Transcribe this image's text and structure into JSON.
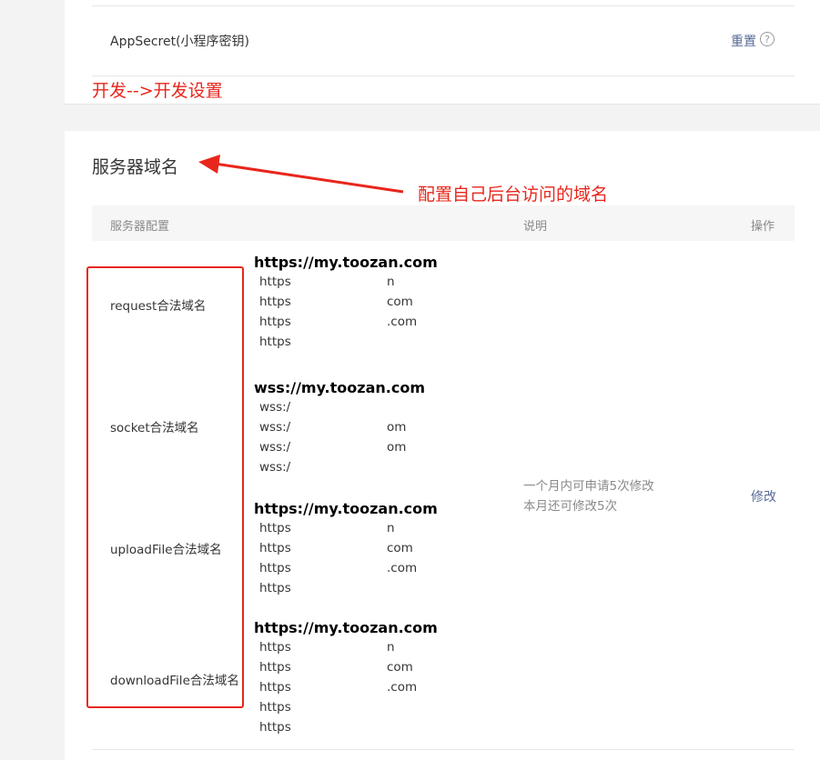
{
  "app_secret": {
    "label": "AppSecret(小程序密钥)",
    "reset_label": "重置",
    "help_icon": "?"
  },
  "annotations": {
    "dev_path": "开发-->开发设置",
    "server_note": "配置自己后台访问的域名"
  },
  "server_domain": {
    "title": "服务器域名",
    "columns": {
      "config": "服务器配置",
      "description": "说明",
      "operation": "操作"
    },
    "rows": [
      {
        "label": "request合法域名",
        "head": "https://my.toozan.com",
        "lines": [
          {
            "prefix": "https",
            "suffix": "n"
          },
          {
            "prefix": "https",
            "suffix": "com"
          },
          {
            "prefix": "https",
            "suffix": ".com"
          },
          {
            "prefix": "https",
            "suffix": ""
          }
        ]
      },
      {
        "label": "socket合法域名",
        "head": "wss://my.toozan.com",
        "lines": [
          {
            "prefix": "wss:/",
            "suffix": ""
          },
          {
            "prefix": "wss:/",
            "suffix": "om"
          },
          {
            "prefix": "wss:/",
            "suffix": "om"
          },
          {
            "prefix": "wss:/",
            "suffix": ""
          }
        ]
      },
      {
        "label": "uploadFile合法域名",
        "head": "https://my.toozan.com",
        "lines": [
          {
            "prefix": "https",
            "suffix": "n"
          },
          {
            "prefix": "https",
            "suffix": "com"
          },
          {
            "prefix": "https",
            "suffix": ".com"
          },
          {
            "prefix": "https",
            "suffix": ""
          }
        ]
      },
      {
        "label": "downloadFile合法域名",
        "head": "https://my.toozan.com",
        "lines": [
          {
            "prefix": "https",
            "suffix": "n"
          },
          {
            "prefix": "https",
            "suffix": "com"
          },
          {
            "prefix": "https",
            "suffix": ".com"
          },
          {
            "prefix": "https",
            "suffix": ""
          },
          {
            "prefix": "https",
            "suffix": ""
          }
        ]
      }
    ],
    "description_lines": [
      "一个月内可申请5次修改",
      "本月还可修改5次"
    ],
    "modify_label": "修改"
  },
  "colors": {
    "annotation": "#e8261c",
    "link": "#576b95"
  }
}
